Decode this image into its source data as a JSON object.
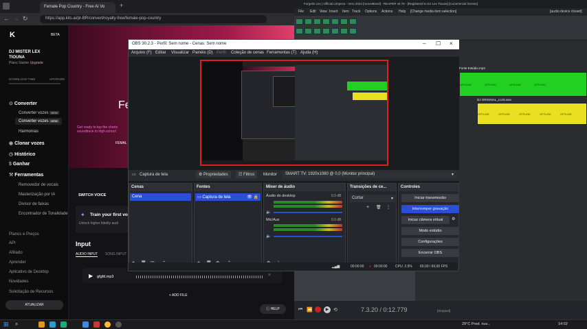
{
  "browser": {
    "tabs": [
      "Female Pop Country - Free AI Vo",
      ""
    ],
    "url": "https://app.kits.ai/pt-BR/convert/royalty-free/female-pop-country",
    "logo_badge": "BETA",
    "user_name": "DJ MISTER LEX TIOUNA",
    "plan_text": "Plano Starter",
    "upgrade_link": "Upgrade",
    "download_label": "DOWNLOAD TIME",
    "upgrade_small": "UPGRADE",
    "nav": [
      {
        "label": "Converter",
        "header": true
      },
      {
        "label": "Converter vozes",
        "badge": "NEW"
      },
      {
        "label": "Converter vozes",
        "badge": "NEW"
      },
      {
        "label": "Harmonias"
      },
      {
        "label": "Clonar vozes",
        "header": true
      },
      {
        "label": "Histórico",
        "header": true
      },
      {
        "label": "Ganhar",
        "header": true
      },
      {
        "label": "Ferramentas",
        "header": true
      },
      {
        "label": "Removedor de vocais"
      },
      {
        "label": "Masterização por IA"
      },
      {
        "label": "Divisor de faixas"
      },
      {
        "label": "Encontrador de Tonalidade"
      }
    ],
    "footer_nav": [
      "Planos e Preços",
      "API",
      "Afiliado",
      "Aprender",
      "Aplicativo de Desktop",
      "Novidades",
      "Solicitação de Recursos"
    ],
    "atualizar": "ATUALIZAR",
    "hero_title": "Fe",
    "hero_sub": "Get ready to top the charts\nsoundtrack to high school",
    "hero_tag": "FEMAL",
    "switch_voice": "SWITCH VOICE",
    "train_title": "Train your first vo",
    "train_sub": "Unlock higher fidelity audi",
    "input_title": "Input",
    "input_tabs": [
      "AUDIO INPUT",
      "SONG INPUT"
    ],
    "file_name": "gfgfd.mp3",
    "add_file": "+ ADD FILE",
    "help": "HELP"
  },
  "daw": {
    "title": "Forgelin Lex | Official Limpeza - Vero 2024 [monoMixed] - REAPER v6.78 - [Registered to DJ Lex Tiouna] [Commercial license]",
    "menu": [
      "File",
      "Edit",
      "View",
      "Insert",
      "Item",
      "Track",
      "Options",
      "Actions",
      "Help",
      "[Change media item selection]"
    ],
    "status": "[audio device closed]",
    "clip1_name": "Fonte Estúdio.mp3",
    "clip2_name": "DJ ORIGINAL_LUIS.wav",
    "offline": "OFFLINE",
    "time": "7.3.20 / 0:12.779",
    "stopped": "[Stopped]"
  },
  "obs": {
    "title": "OBS 30.2.3 - Perfil: Sem nome - Cenas: Sem nome",
    "menu": [
      "Arquivo (F)",
      "Editar",
      "Visualizar",
      "Painéis (D)",
      "Perfil",
      "Coleção de cenas",
      "Ferramentas (T)",
      "Ajuda (H)"
    ],
    "source_name": "Captura de tela",
    "properties": "Propriedades",
    "filters": "Filtros",
    "monitor_label": "Monitor",
    "monitor_value": "SMART TV: 1920x1080 @ 0,0 (Monitor principal)",
    "docks": {
      "scenes": "Cenas",
      "sources": "Fontes",
      "mixer": "Mixer de áudio",
      "transitions": "Transições de ce...",
      "controls": "Controles"
    },
    "scene_item": "Cena",
    "source_item": "Captura de tela",
    "mixer_tracks": [
      {
        "name": "Áudio do desktop",
        "db": "0.0 dB"
      },
      {
        "name": "Mic/Aux",
        "db": "0.0 dB"
      }
    ],
    "transition": "Cortar",
    "controls": [
      "Iniciar transmissão",
      "Interromper gravação",
      "Iniciar câmera virtual",
      "Modo estúdio",
      "Configurações",
      "Encerrar OBS"
    ],
    "status_time": "00:00:00",
    "status_rec": "00:00:00",
    "cpu": "CPU: 2.9%",
    "fps": "60,00 / 60,00 FPS"
  },
  "taskbar": {
    "weather": "29°C  Pred. nuv...",
    "clock": "14:02"
  },
  "colors": {
    "accent_pink": "#e0406a",
    "obs_blue": "#2a4fd6",
    "clip_green": "#22d022",
    "clip_yellow": "#e8e020"
  }
}
